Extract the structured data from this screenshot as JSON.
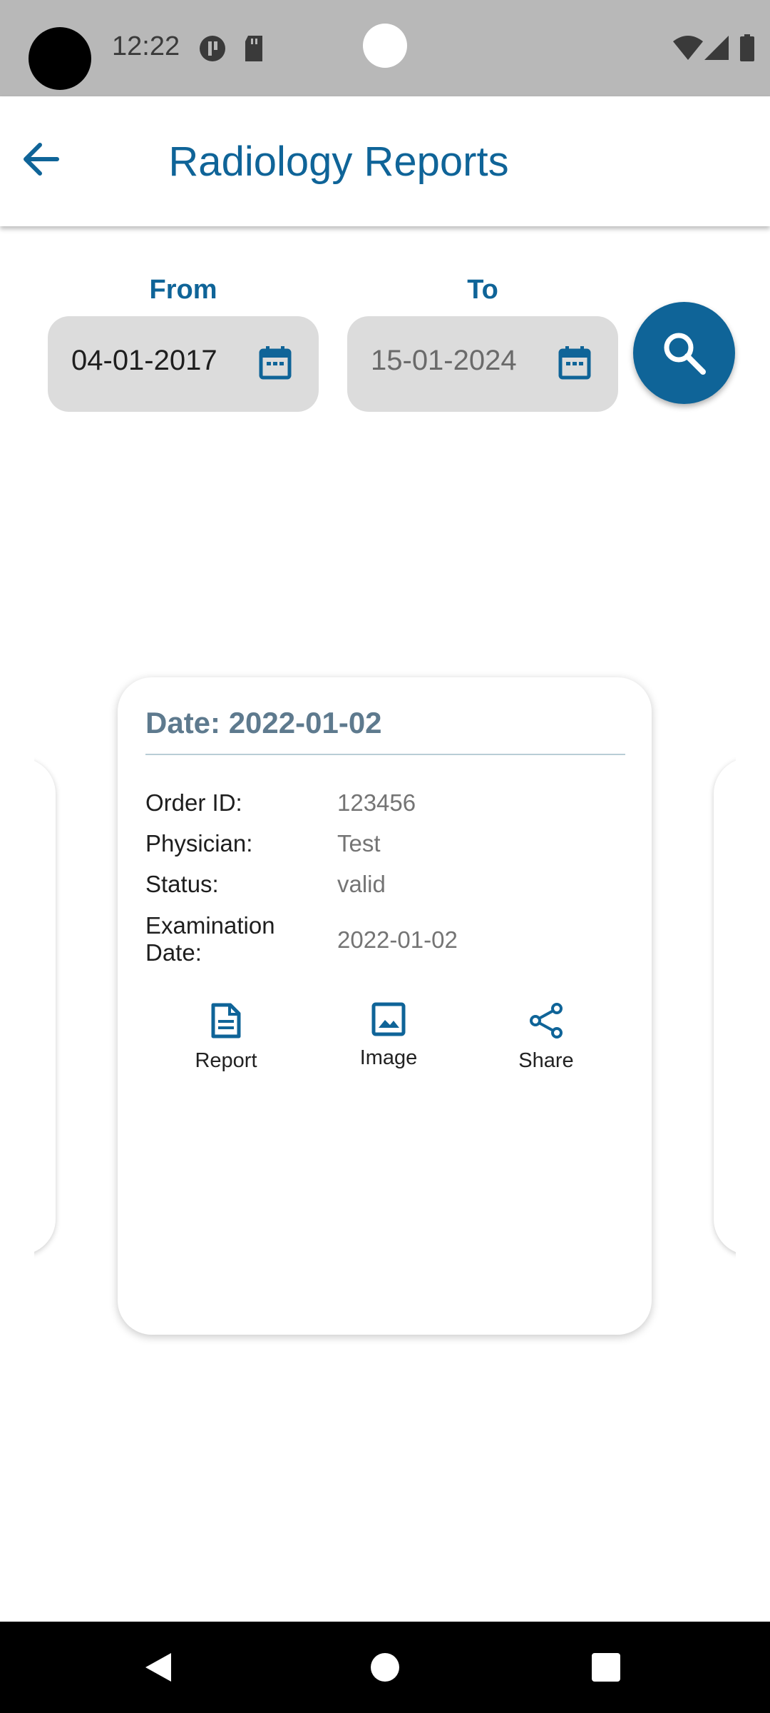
{
  "status_bar": {
    "time": "12:22"
  },
  "header": {
    "title": "Radiology Reports"
  },
  "filters": {
    "from_label": "From",
    "to_label": "To",
    "from_date": "04-01-2017",
    "to_date": "15-01-2024"
  },
  "card": {
    "date": "Date: 2022-01-02",
    "fields": [
      {
        "label": "Order ID:",
        "value": "123456"
      },
      {
        "label": "Physician:",
        "value": "Test"
      },
      {
        "label": "Status:",
        "value": "valid"
      },
      {
        "label": "Examination Date:",
        "value": "2022-01-02"
      }
    ],
    "actions": [
      {
        "label": "Report",
        "icon": "document-icon"
      },
      {
        "label": "Image",
        "icon": "image-icon"
      },
      {
        "label": "Share",
        "icon": "share-icon"
      }
    ]
  },
  "colors": {
    "primary": "#0f6498",
    "card_title": "#5e7a8e",
    "field_bg": "#dcdcdc"
  }
}
